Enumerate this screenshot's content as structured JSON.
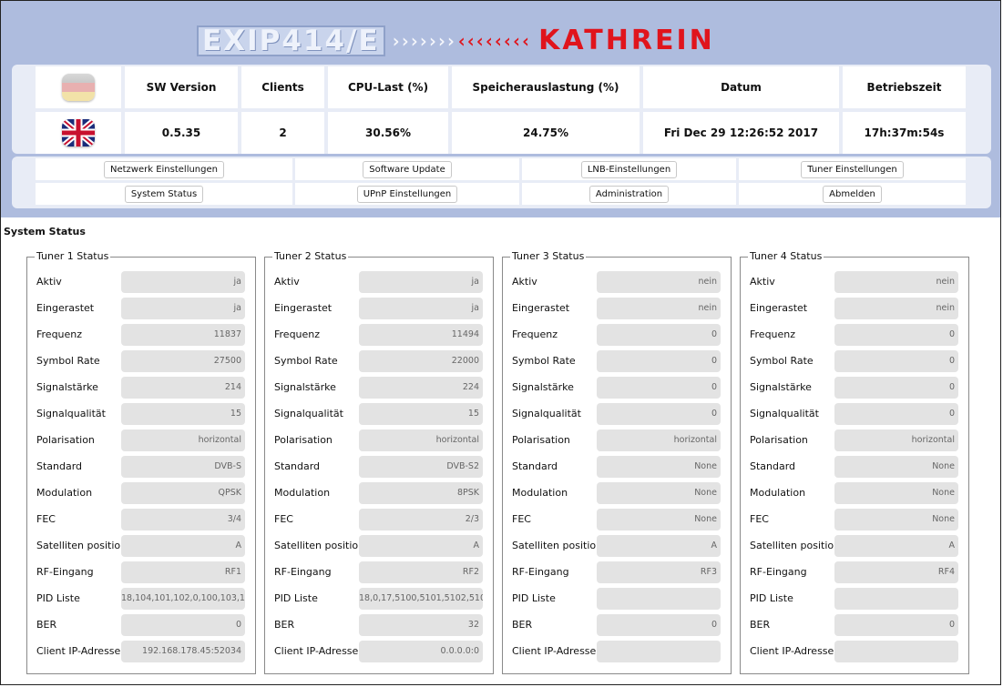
{
  "branding": {
    "product": "EXIP414/E",
    "chevrons_white": "›››››››",
    "chevrons_red": "‹‹‹‹‹‹‹‹",
    "brand": "KATHREIN",
    "colors": {
      "header_bg": "#aebcde",
      "brand_red": "#e0141c"
    }
  },
  "info": {
    "languages": [
      {
        "icon": "german-flag-icon"
      },
      {
        "icon": "uk-flag-icon"
      }
    ],
    "headers": [
      "SW Version",
      "Clients",
      "CPU-Last (%)",
      "Speicherauslastung (%)",
      "Datum",
      "Betriebszeit"
    ],
    "values": [
      "0.5.35",
      "2",
      "30.56%",
      "24.75%",
      "Fri Dec 29 12:26:52 2017",
      "17h:37m:54s"
    ]
  },
  "nav": {
    "row1": [
      "Netzwerk Einstellungen",
      "Software Update",
      "LNB-Einstellungen",
      "Tuner Einstellungen"
    ],
    "row2": [
      "System Status",
      "UPnP Einstellungen",
      "Administration",
      "Abmelden"
    ]
  },
  "section_title": "System Status",
  "row_labels": [
    "Aktiv",
    "Eingerastet",
    "Frequenz",
    "Symbol Rate",
    "Signalstärke",
    "Signalqualität",
    "Polarisation",
    "Standard",
    "Modulation",
    "FEC",
    "Satelliten position",
    "RF-Eingang",
    "PID Liste",
    "BER",
    "Client IP-Adresse"
  ],
  "tuners": [
    {
      "title": "Tuner 1 Status",
      "values": [
        "ja",
        "ja",
        "11837",
        "27500",
        "214",
        "15",
        "horizontal",
        "DVB-S",
        "QPSK",
        "3/4",
        "A",
        "RF1",
        "18,104,101,102,0,100,103,1",
        "0",
        "192.168.178.45:52034"
      ]
    },
    {
      "title": "Tuner 2 Status",
      "values": [
        "ja",
        "ja",
        "11494",
        "22000",
        "224",
        "15",
        "horizontal",
        "DVB-S2",
        "8PSK",
        "2/3",
        "A",
        "RF2",
        "18,0,17,5100,5101,5102,510",
        "32",
        "0.0.0.0:0"
      ]
    },
    {
      "title": "Tuner 3 Status",
      "values": [
        "nein",
        "nein",
        "0",
        "0",
        "0",
        "0",
        "horizontal",
        "None",
        "None",
        "None",
        "A",
        "RF3",
        "",
        "0",
        ""
      ]
    },
    {
      "title": "Tuner 4 Status",
      "values": [
        "nein",
        "nein",
        "0",
        "0",
        "0",
        "0",
        "horizontal",
        "None",
        "None",
        "None",
        "A",
        "RF4",
        "",
        "0",
        ""
      ]
    }
  ]
}
